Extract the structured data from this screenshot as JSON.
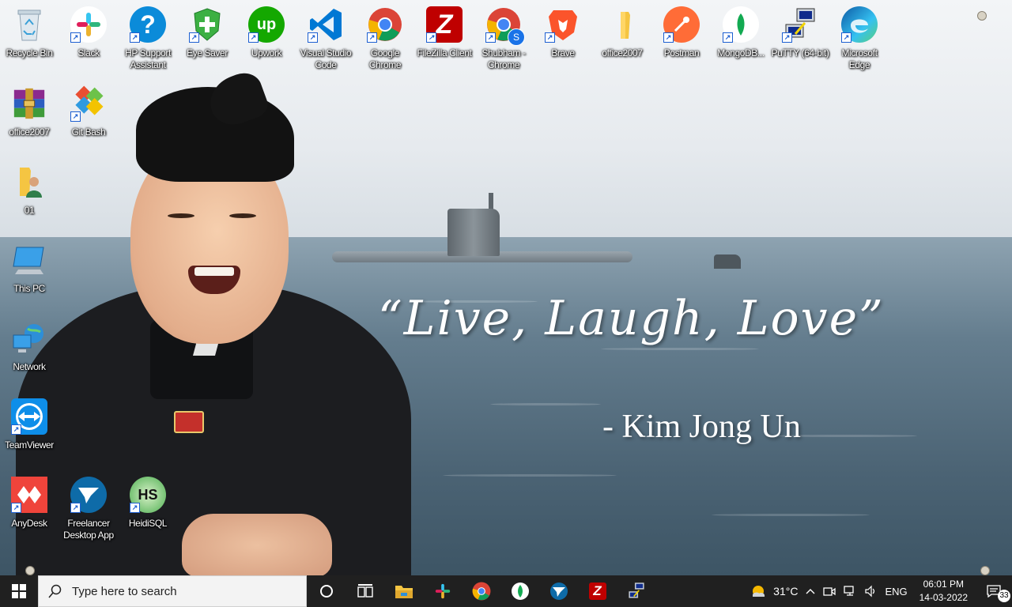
{
  "wallpaper": {
    "quote": "“Live, Laugh, Love”",
    "author": "- Kim Jong Un"
  },
  "desktop_icons": [
    {
      "name": "recycle-bin-icon",
      "label": "Recycle Bin"
    },
    {
      "name": "slack-icon",
      "label": "Slack"
    },
    {
      "name": "hp-support-assistant-icon",
      "label": "HP Support Assistant"
    },
    {
      "name": "eye-saver-icon",
      "label": "Eye Saver"
    },
    {
      "name": "upwork-icon",
      "label": "Upwork"
    },
    {
      "name": "vscode-icon",
      "label": "Visual Studio Code"
    },
    {
      "name": "google-chrome-icon",
      "label": "Google Chrome"
    },
    {
      "name": "filezilla-icon",
      "label": "FileZilla Client"
    },
    {
      "name": "chrome-profile-icon",
      "label": "Shubham - Chrome"
    },
    {
      "name": "brave-icon",
      "label": "Brave"
    },
    {
      "name": "folder-icon",
      "label": "office2007"
    },
    {
      "name": "postman-icon",
      "label": "Postman"
    },
    {
      "name": "mongodb-compass-icon",
      "label": "MongoDB..."
    },
    {
      "name": "putty-icon",
      "label": "PuTTY (64-bit)"
    },
    {
      "name": "microsoft-edge-icon",
      "label": "Microsoft Edge"
    },
    {
      "name": "winrar-archive-icon",
      "label": "office2007"
    },
    {
      "name": "git-bash-icon",
      "label": "Git Bash"
    },
    {
      "name": "user-folder-icon",
      "label": "01"
    },
    {
      "name": "this-pc-icon",
      "label": "This PC"
    },
    {
      "name": "network-icon",
      "label": "Network"
    },
    {
      "name": "teamviewer-icon",
      "label": "TeamViewer"
    },
    {
      "name": "anydesk-icon",
      "label": "AnyDesk"
    },
    {
      "name": "freelancer-icon",
      "label": "Freelancer Desktop App"
    },
    {
      "name": "heidisql-icon",
      "label": "HeidiSQL"
    }
  ],
  "icon_glyphs": {
    "upwork": "up",
    "filezilla": "Z",
    "chrome_profile_badge": "S",
    "heidisql": "HS",
    "taskbar_filezilla": "Z",
    "shortcut_arrow": "↗"
  },
  "taskbar": {
    "search_placeholder": "Type here to search",
    "pinned": [
      "cortana-icon",
      "task-view-icon",
      "file-explorer-icon",
      "slack-icon",
      "google-chrome-icon",
      "mongodb-compass-icon",
      "freelancer-icon",
      "filezilla-icon",
      "putty-icon"
    ],
    "weather": "31°C",
    "language": "ENG",
    "time": "06:01 PM",
    "date": "14-03-2022",
    "notification_count": "33"
  },
  "colors": {
    "taskbar_bg": "#202020",
    "search_bg": "#f3f3f3",
    "accent": "#76b9ed"
  }
}
